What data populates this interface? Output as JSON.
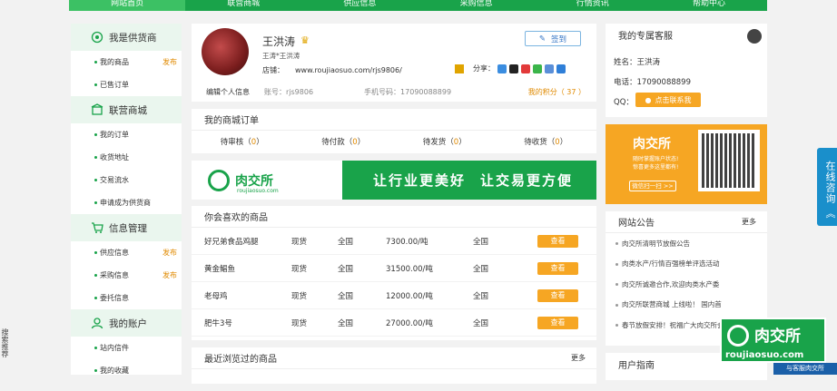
{
  "topnav": {
    "items": [
      "网站首页",
      "联营商城",
      "供应信息",
      "采购信息",
      "行情资讯",
      "帮助中心"
    ]
  },
  "left": {
    "sections": [
      {
        "title": "我是供货商",
        "items": [
          {
            "label": "我的商品",
            "pub": "发布"
          },
          {
            "label": "已售订单",
            "pub": ""
          }
        ]
      },
      {
        "title": "联营商城",
        "items": [
          {
            "label": "我的订单",
            "pub": ""
          },
          {
            "label": "收货地址",
            "pub": ""
          },
          {
            "label": "交易流水",
            "pub": ""
          },
          {
            "label": "申请成为供货商",
            "pub": ""
          }
        ]
      },
      {
        "title": "信息管理",
        "items": [
          {
            "label": "供应信息",
            "pub": "发布"
          },
          {
            "label": "采购信息",
            "pub": "发布"
          },
          {
            "label": "委托信息",
            "pub": ""
          }
        ]
      },
      {
        "title": "我的账户",
        "items": [
          {
            "label": "站内信件",
            "pub": ""
          },
          {
            "label": "我的收藏",
            "pub": ""
          }
        ]
      }
    ]
  },
  "profile": {
    "name": "王洪涛",
    "sub": "王涛*王洪涛",
    "shop_label": "店铺：",
    "shop_url": "www.roujiaosuo.com/rjs9806/",
    "share_label": "分享：",
    "sign": "签到",
    "edit": "编辑个人信息",
    "account": "账号：rjs9806",
    "phone": "手机号码：17090088899",
    "points": "我的积分（ 37 ）"
  },
  "orders": {
    "title": "我的商城订单",
    "items": [
      {
        "label": "待审核（",
        "count": "0",
        "end": "）"
      },
      {
        "label": "待付款（",
        "count": "0",
        "end": "）"
      },
      {
        "label": "待发货（",
        "count": "0",
        "end": "）"
      },
      {
        "label": "待收货（",
        "count": "0",
        "end": "）"
      }
    ]
  },
  "banner": {
    "logo": "肉交所",
    "url": "roujiaosuo.com",
    "slogan1": "让行业更美好",
    "slogan2": "让交易更方便"
  },
  "fav": {
    "title": "你会喜欢的商品",
    "view": "查看",
    "rows": [
      {
        "name": "好兄弟食品鸡腿",
        "stock": "现货",
        "area": "全国",
        "price": "7300.00/吨",
        "region": "全国"
      },
      {
        "name": "黄金鲳鱼",
        "stock": "现货",
        "area": "全国",
        "price": "31500.00/吨",
        "region": "全国"
      },
      {
        "name": "老母鸡",
        "stock": "现货",
        "area": "全国",
        "price": "12000.00/吨",
        "region": "全国"
      },
      {
        "name": "肥牛3号",
        "stock": "现货",
        "area": "全国",
        "price": "27000.00/吨",
        "region": "全国"
      }
    ]
  },
  "recent": {
    "title": "最近浏览过的商品",
    "more": "更多"
  },
  "service": {
    "title": "我的专属客服",
    "name": "姓名：王洪涛",
    "phone": "电话：17090088899",
    "qq": "QQ：",
    "qq_btn": "点击联系我"
  },
  "ad": {
    "title": "肉交所",
    "sub1": "随时掌握账户状态!",
    "sub2": "惊喜更多这里都有!",
    "btn": "微信扫一扫 >>"
  },
  "notice": {
    "title": "网站公告",
    "more": "更多",
    "items": [
      "肉交所清明节放假公告",
      "肉类水产/行情百强榜单评选活动",
      "肉交所诚邀合作,欢迎肉类水产委",
      "肉交所联营商城 上线啦！ 国内首",
      "春节放假安排！祝福广大肉交所会"
    ]
  },
  "guide": {
    "title": "用户指南"
  },
  "online": "在线咨询 《",
  "sidesearch": "搜索推荐",
  "float": {
    "title": "肉交所",
    "url": "roujiaosuo.com",
    "bar": "与客服肉交所"
  }
}
